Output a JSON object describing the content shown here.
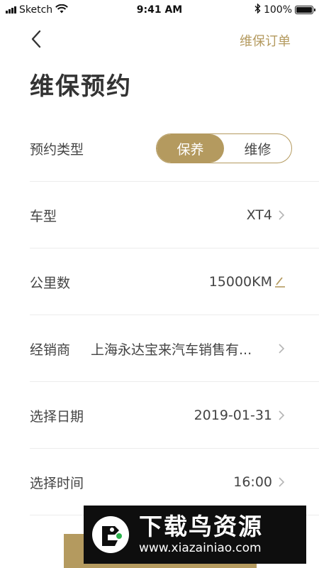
{
  "status_bar": {
    "carrier": "Sketch",
    "time": "9:41 AM",
    "battery": "100%",
    "battery_level": 1.0
  },
  "nav": {
    "back_icon": "chevron-left-icon",
    "orders_link": "维保订单"
  },
  "page": {
    "title": "维保预约"
  },
  "form": {
    "type_row": {
      "label": "预约类型",
      "options": [
        "保养",
        "维修"
      ],
      "selected": "保养"
    },
    "rows": [
      {
        "label": "车型",
        "value": "XT4",
        "icon": "chevron-right-icon"
      },
      {
        "label": "公里数",
        "value": "15000KM",
        "icon": "edit-icon"
      },
      {
        "label": "经销商",
        "value": "上海永达宝来汽车销售有...",
        "icon": "chevron-right-icon"
      },
      {
        "label": "选择日期",
        "value": "2019-01-31",
        "icon": "chevron-right-icon"
      },
      {
        "label": "选择时间",
        "value": "16:00",
        "icon": "chevron-right-icon"
      }
    ]
  },
  "watermark": {
    "title": "下载鸟资源",
    "url": "www.xiazainiao.com"
  },
  "colors": {
    "accent": "#b49a5f",
    "text": "#444444",
    "divider": "#ececec",
    "watermark_bg": "#0e0e0e"
  }
}
